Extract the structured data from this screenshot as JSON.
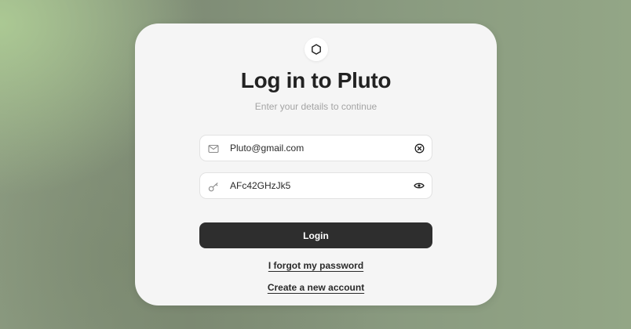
{
  "header": {
    "logo_icon": "hexagon-icon",
    "title": "Log in to Pluto",
    "subtitle": "Enter your details to continue"
  },
  "form": {
    "email": {
      "lead_icon": "mail-icon",
      "value": "Pluto@gmail.com",
      "trail_icon": "clear-icon"
    },
    "password": {
      "lead_icon": "key-icon",
      "value": "AFc42GHzJk5",
      "trail_icon": "eye-icon"
    },
    "login_label": "Login"
  },
  "links": {
    "forgot_password": "I forgot my password",
    "create_account": "Create a new account"
  },
  "colors": {
    "button_bg": "#2e2e2e",
    "card_bg": "#f5f5f5",
    "title": "#222222",
    "subtitle": "#a4a4a4"
  }
}
